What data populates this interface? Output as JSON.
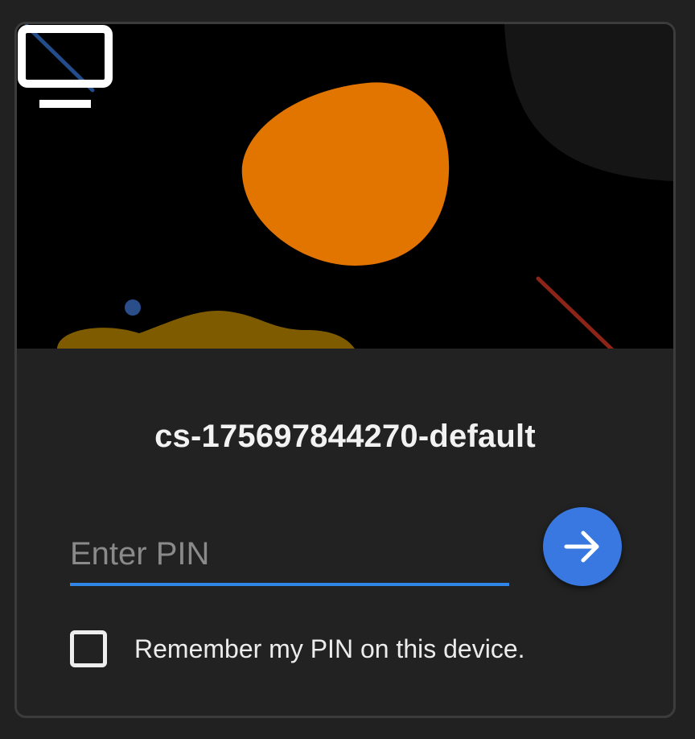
{
  "host": {
    "name": "cs-175697844270-default"
  },
  "pin": {
    "placeholder": "Enter PIN",
    "value": ""
  },
  "remember": {
    "label": "Remember my PIN on this device.",
    "checked": false
  },
  "icons": {
    "hero": "monitor-icon",
    "submit": "arrow-right-icon"
  },
  "colors": {
    "hero_blob": "#e27400",
    "accent_blue": "#3878e0",
    "underline": "#2f86e6",
    "background": "#212121"
  }
}
